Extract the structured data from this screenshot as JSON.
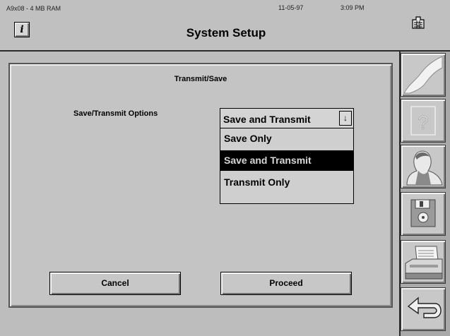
{
  "header": {
    "device_info": "A9x08 - 4 MB RAM",
    "date": "11-05-97",
    "time": "3:09 PM",
    "title": "System Setup",
    "info_button_label": "i"
  },
  "dialog": {
    "title": "Transmit/Save",
    "options_label": "Save/Transmit Options",
    "dropdown": {
      "selected_value": "Save and Transmit",
      "arrow": "↓",
      "options": [
        {
          "label": "Save Only",
          "selected": false
        },
        {
          "label": "Save and Transmit",
          "selected": true
        },
        {
          "label": "Transmit Only",
          "selected": false
        }
      ]
    },
    "cancel_label": "Cancel",
    "proceed_label": "Proceed"
  },
  "toolbar": {
    "icons": [
      "scroll-icon",
      "help-icon",
      "person-icon",
      "floppy-disk-icon",
      "printer-icon",
      "back-arrow-icon"
    ]
  }
}
